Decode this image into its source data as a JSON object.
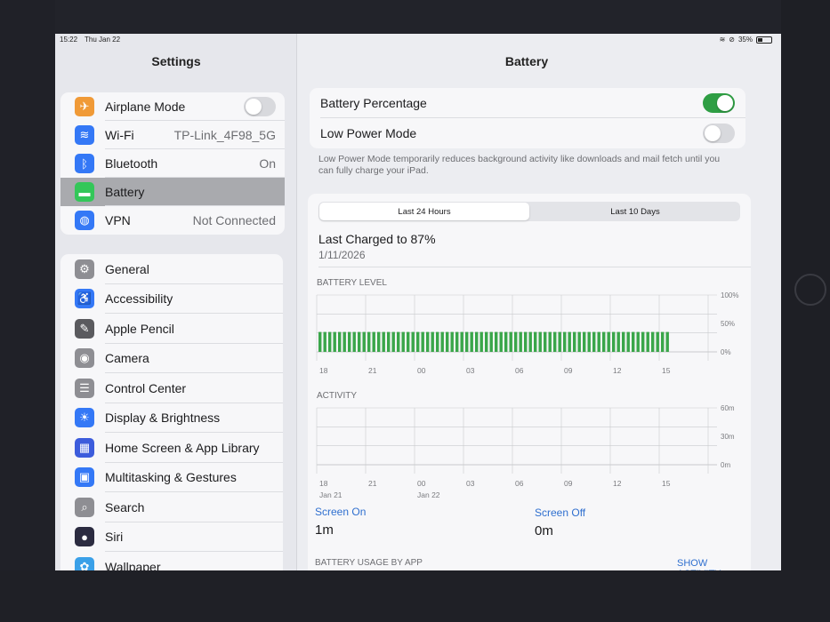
{
  "status": {
    "time": "15:22",
    "date": "Thu Jan 22",
    "battery": "35%"
  },
  "sidebar": {
    "title": "Settings",
    "group1": [
      {
        "label": "Airplane Mode",
        "icon": "airplane-icon",
        "color": "#f09a37",
        "glyph": "✈",
        "toggle": false
      },
      {
        "label": "Wi-Fi",
        "value": "TP-Link_4F98_5G",
        "icon": "wifi-icon",
        "color": "#3478f6",
        "glyph": "≋"
      },
      {
        "label": "Bluetooth",
        "value": "On",
        "icon": "bluetooth-icon",
        "color": "#3478f6",
        "glyph": "ᛒ"
      },
      {
        "label": "Battery",
        "icon": "battery-icon",
        "color": "#34c759",
        "glyph": "▬",
        "selected": true
      },
      {
        "label": "VPN",
        "value": "Not Connected",
        "icon": "vpn-icon",
        "color": "#3478f6",
        "glyph": "◍"
      }
    ],
    "group2": [
      {
        "label": "General",
        "icon": "gear-icon",
        "color": "#8e8e93",
        "glyph": "⚙"
      },
      {
        "label": "Accessibility",
        "icon": "accessibility-icon",
        "color": "#3478f6",
        "glyph": "♿"
      },
      {
        "label": "Apple Pencil",
        "icon": "pencil-icon",
        "color": "#5a5a5e",
        "glyph": "✎"
      },
      {
        "label": "Camera",
        "icon": "camera-icon",
        "color": "#8e8e93",
        "glyph": "◉"
      },
      {
        "label": "Control Center",
        "icon": "control-center-icon",
        "color": "#8e8e93",
        "glyph": "☰"
      },
      {
        "label": "Display & Brightness",
        "icon": "brightness-icon",
        "color": "#3478f6",
        "glyph": "☀"
      },
      {
        "label": "Home Screen & App Library",
        "icon": "home-screen-icon",
        "color": "#3c5cdc",
        "glyph": "▦"
      },
      {
        "label": "Multitasking & Gestures",
        "icon": "multitasking-icon",
        "color": "#3478f6",
        "glyph": "▣"
      },
      {
        "label": "Search",
        "icon": "search-icon",
        "color": "#8e8e93",
        "glyph": "⌕"
      },
      {
        "label": "Siri",
        "icon": "siri-icon",
        "color": "#2b2b40",
        "glyph": "●"
      },
      {
        "label": "Wallpaper",
        "icon": "wallpaper-icon",
        "color": "#3aa0e8",
        "glyph": "✿"
      }
    ]
  },
  "detail": {
    "title": "Battery",
    "battery_percentage_label": "Battery Percentage",
    "battery_percentage_on": true,
    "low_power_label": "Low Power Mode",
    "low_power_on": false,
    "footnote": "Low Power Mode temporarily reduces background activity like downloads and mail fetch until you can fully charge your iPad.",
    "tabs": [
      "Last 24 Hours",
      "Last 10 Days"
    ],
    "active_tab": 0,
    "last_charged": "Last Charged to 87%",
    "last_charged_date": "1/11/2026",
    "battery_level_caption": "BATTERY LEVEL",
    "activity_caption": "ACTIVITY",
    "screen_on_label": "Screen On",
    "screen_on_value": "1m",
    "screen_off_label": "Screen Off",
    "screen_off_value": "0m",
    "usage_caption": "BATTERY USAGE BY APP",
    "show_activity": "SHOW ACTIVITY"
  },
  "chart_data": [
    {
      "type": "bar",
      "title": "BATTERY LEVEL",
      "x_ticks": [
        "18",
        "21",
        "00",
        "03",
        "06",
        "09",
        "12",
        "15"
      ],
      "y_ticks": [
        "100%",
        "50%",
        "0%"
      ],
      "ylim": [
        0,
        100
      ],
      "bar_color": "#3aa64a",
      "bar_count": 72,
      "values_level": 35
    },
    {
      "type": "bar",
      "title": "ACTIVITY",
      "x_ticks": [
        "18",
        "21",
        "00",
        "03",
        "06",
        "09",
        "12",
        "15"
      ],
      "x_subticks": {
        "0": "Jan 21",
        "2": "Jan 22"
      },
      "y_ticks": [
        "60m",
        "30m",
        "0m"
      ],
      "ylim": [
        0,
        60
      ],
      "values": [
        0,
        0,
        0,
        0,
        0,
        0,
        0,
        0
      ]
    }
  ]
}
